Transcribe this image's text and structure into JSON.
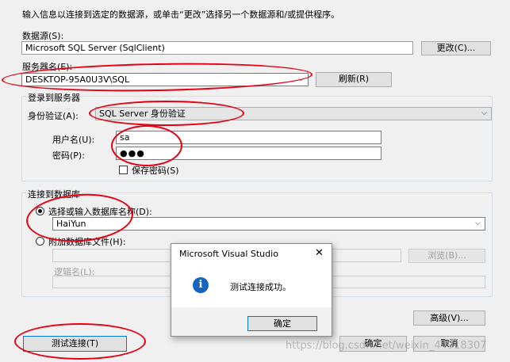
{
  "instructions": "输入信息以连接到选定的数据源，或单击“更改”选择另一个数据源和/或提供程序。",
  "datasource": {
    "label": "数据源(S):",
    "value": "Microsoft SQL Server (SqlClient)",
    "change_button": "更改(C)..."
  },
  "server": {
    "label": "服务器名(E):",
    "value": "DESKTOP-95A0U3V\\SQL",
    "refresh_button": "刷新(R)"
  },
  "login": {
    "group_label": "登录到服务器",
    "auth_label": "身份验证(A):",
    "auth_value": "SQL Server 身份验证",
    "username_label": "用户名(U):",
    "username_value": "sa",
    "password_label": "密码(P):",
    "password_value": "●●●",
    "save_password_label": "保存密码(S)"
  },
  "database": {
    "group_label": "连接到数据库",
    "select_radio_label": "选择或输入数据库名称(D):",
    "select_value": "HaiYun",
    "attach_radio_label": "附加数据库文件(H):",
    "browse_button": "浏览(B)...",
    "logical_name_label": "逻辑名(L):"
  },
  "buttons": {
    "advanced": "高级(V)...",
    "test": "测试连接(T)",
    "ok": "确定",
    "cancel": "取消"
  },
  "dialog": {
    "title": "Microsoft Visual Studio",
    "close": "✕",
    "message": "测试连接成功。",
    "icon": "i",
    "ok_button": "确定"
  },
  "watermark": "https://blog.csdn.net/weixin_44918307",
  "colors": {
    "annotation": "#e60012",
    "info_icon": "#1565c0",
    "window_bg": "#f0f0f0"
  }
}
